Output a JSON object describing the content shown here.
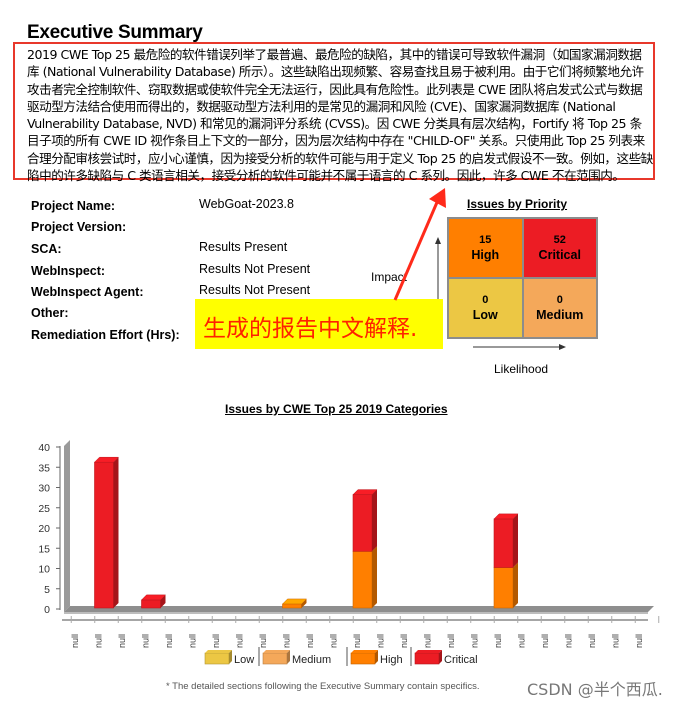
{
  "title": "Executive Summary",
  "summary_text": "2019 CWE Top 25 最危险的软件错误列举了最普遍、最危险的缺陷，其中的错误可导致软件漏洞（如国家漏洞数据库 (National Vulnerability Database) 所示）。这些缺陷出现频繁、容易查找且易于被利用。由于它们将频繁地允许攻击者完全控制软件、窃取数据或使软件完全无法运行，因此具有危险性。此列表是 CWE 团队将启发式公式与数据驱动型方法结合使用而得出的，数据驱动型方法利用的是常见的漏洞和风险 (CVE)、国家漏洞数据库 (National Vulnerability Database, NVD) 和常见的漏洞评分系统 (CVSS)。因 CWE 分类具有层次结构，Fortify 将 Top 25 条目子项的所有 CWE ID 视作条目上下文的一部分，因为层次结构中存在 \"CHILD-OF\" 关系。只使用此 Top 25 列表来合理分配审核尝试时，应小心谨慎，因为接受分析的软件可能与用于定义 Top 25 的启发式假设不一致。例如，这些缺陷中的许多缺陷与 C 类语言相关，接受分析的软件可能并不属于语言的 C 系列。因此，许多 CWE 不在范围内。",
  "project_info": [
    {
      "label": "Project Name:",
      "value": "WebGoat-2023.8"
    },
    {
      "label": "Project Version:",
      "value": ""
    },
    {
      "label": "SCA:",
      "value": "Results Present"
    },
    {
      "label": "WebInspect:",
      "value": "Results Not Present"
    },
    {
      "label": "WebInspect Agent:",
      "value": "Results Not Present"
    },
    {
      "label": "Other:",
      "value": ""
    },
    {
      "label": "Remediation Effort (Hrs):",
      "value": ""
    }
  ],
  "annotation": "生成的报告中文解释.",
  "priority": {
    "title": "Issues by Priority",
    "impact_label": "Impact",
    "likelihood_label": "Likelihood",
    "cells": [
      {
        "count": "15",
        "label": "High",
        "color": "#ff7f00"
      },
      {
        "count": "52",
        "label": "Critical",
        "color": "#ec1c24"
      },
      {
        "count": "0",
        "label": "Low",
        "color": "#ecc744"
      },
      {
        "count": "0",
        "label": "Medium",
        "color": "#f4a85a"
      }
    ]
  },
  "chart_data": {
    "type": "bar",
    "stacked": true,
    "title": "Issues by CWE Top 25 2019 Categories",
    "xlabel": "",
    "ylabel": "",
    "ylim": [
      0,
      40
    ],
    "yticks": [
      0,
      5,
      10,
      15,
      20,
      25,
      30,
      35,
      40
    ],
    "categories": [
      "null",
      "null",
      "null",
      "null",
      "null",
      "null",
      "null",
      "null",
      "null",
      "null",
      "null",
      "null",
      "null",
      "null",
      "null",
      "null",
      "null",
      "null",
      "null",
      "null",
      "null",
      "null",
      "null",
      "null",
      "null"
    ],
    "series": [
      {
        "name": "Low",
        "color": "#ecc744",
        "values": [
          0,
          0,
          0,
          0,
          0,
          0,
          0,
          0,
          0,
          0,
          0,
          0,
          0,
          0,
          0,
          0,
          0,
          0,
          0,
          0,
          0,
          0,
          0,
          0,
          0
        ]
      },
      {
        "name": "Medium",
        "color": "#f4a85a",
        "values": [
          0,
          0,
          0,
          0,
          0,
          0,
          0,
          0,
          0,
          0,
          0,
          0,
          0,
          0,
          0,
          0,
          0,
          0,
          0,
          0,
          0,
          0,
          0,
          0,
          0
        ]
      },
      {
        "name": "High",
        "color": "#ff7f00",
        "values": [
          0,
          0,
          0,
          0,
          0,
          0,
          0,
          0,
          0,
          1,
          0,
          0,
          14,
          0,
          0,
          0,
          0,
          0,
          10,
          0,
          0,
          0,
          0,
          0,
          0
        ]
      },
      {
        "name": "Critical",
        "color": "#ec1c24",
        "values": [
          0,
          36,
          0,
          2,
          0,
          0,
          0,
          0,
          0,
          0,
          0,
          0,
          14,
          0,
          0,
          0,
          0,
          0,
          12,
          0,
          0,
          0,
          0,
          0,
          0
        ]
      }
    ],
    "legend": [
      "Low",
      "Medium",
      "High",
      "Critical"
    ],
    "legend_position": "bottom",
    "grid": false
  },
  "footer": "* The detailed sections following the Executive Summary contain specifics.",
  "watermark": "CSDN @半个西瓜."
}
